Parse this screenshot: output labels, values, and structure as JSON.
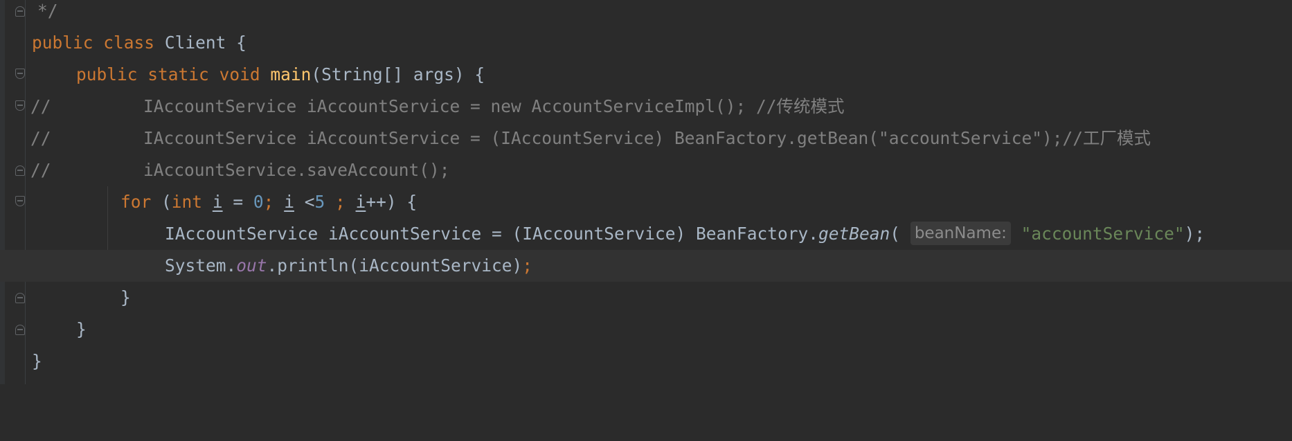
{
  "editor": {
    "lines": {
      "l1": {
        "comment_end": "*/"
      },
      "l2": {
        "kw_public": "public",
        "kw_class": "class",
        "class_name": "Client",
        "brace": "{"
      },
      "l3": {
        "kw_public": "public",
        "kw_static": "static",
        "kw_void": "void",
        "method": "main",
        "params": "(String[] args) {"
      },
      "l4": {
        "comment_marker": "//",
        "comment_text": "IAccountService iAccountService = new AccountServiceImpl(); //传统模式"
      },
      "l5": {
        "comment_marker": "//",
        "comment_text": "IAccountService iAccountService = (IAccountService) BeanFactory.getBean(\"accountService\");//工厂模式"
      },
      "l6": {
        "comment_marker": "//",
        "comment_text": "iAccountService.saveAccount();"
      },
      "l7": {
        "kw_for": "for",
        "open": "(",
        "kw_int": "int",
        "var1": "i",
        "assign": "=",
        "zero": "0",
        "semi1": ";",
        "var2": "i",
        "lt": "<",
        "five": "5",
        "semi2": ";",
        "var3": "i",
        "incr": "++) {"
      },
      "l8": {
        "decl": "IAccountService iAccountService = (IAccountService) BeanFactory.",
        "method": "getBean",
        "open": "(",
        "hint": "beanName:",
        "string": "\"accountService\"",
        "close": ");"
      },
      "l9": {
        "system": "System.",
        "field": "out",
        "call": ".println(iAccountService)",
        "semi": ";"
      },
      "l10": {
        "brace": "}"
      },
      "l11": {
        "brace": "}"
      },
      "l12": {
        "brace": "}"
      }
    }
  }
}
